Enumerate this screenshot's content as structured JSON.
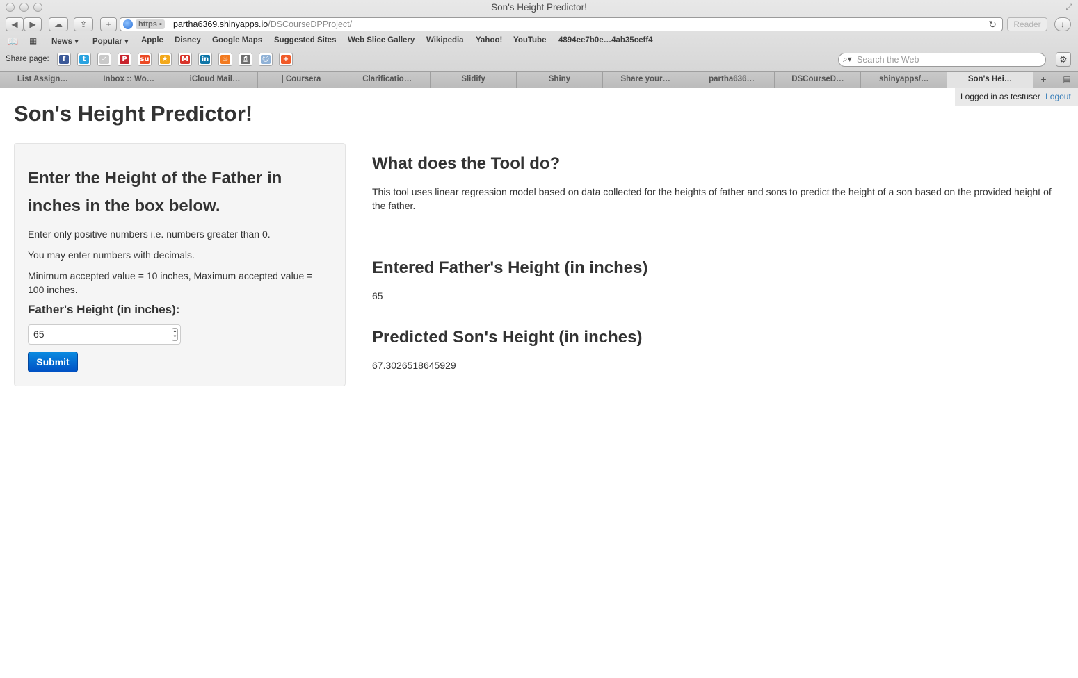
{
  "browser": {
    "window_title": "Son's Height Predictor!",
    "url_scheme": "https",
    "url_host": "partha6369.shinyapps.io",
    "url_path": "/DSCourseDPProject/",
    "reader_label": "Reader",
    "bookmarks": [
      "News ▾",
      "Popular ▾",
      "Apple",
      "Disney",
      "Google Maps",
      "Suggested Sites",
      "Web Slice Gallery",
      "Wikipedia",
      "Yahoo!",
      "YouTube",
      "4894ee7b0e…4ab35ceff4"
    ],
    "share_label": "Share page:",
    "share_icons": [
      {
        "name": "facebook-icon",
        "glyph": "f",
        "color": "#3b5998"
      },
      {
        "name": "twitter-icon",
        "glyph": "t",
        "color": "#2aa3e0"
      },
      {
        "name": "pocket-icon",
        "glyph": "✓",
        "color": "#c9c9c9"
      },
      {
        "name": "pinterest-icon",
        "glyph": "P",
        "color": "#c8232c"
      },
      {
        "name": "stumbleupon-icon",
        "glyph": "su",
        "color": "#eb4924"
      },
      {
        "name": "favorites-icon",
        "glyph": "★",
        "color": "#f3a81b"
      },
      {
        "name": "gmail-icon",
        "glyph": "M",
        "color": "#d8342a"
      },
      {
        "name": "linkedin-icon",
        "glyph": "in",
        "color": "#0e76a8"
      },
      {
        "name": "fire-icon",
        "glyph": "♨",
        "color": "#f27a1f"
      },
      {
        "name": "print-icon",
        "glyph": "⎙",
        "color": "#6d6d6d"
      },
      {
        "name": "reddit-icon",
        "glyph": "☺",
        "color": "#8fb1d6"
      },
      {
        "name": "more-share-icon",
        "glyph": "+",
        "color": "#f05a28"
      }
    ],
    "search_placeholder": "Search the Web",
    "tabs": [
      "List Assign…",
      "Inbox :: Wo…",
      "iCloud Mail…",
      "| Coursera",
      "Clarificatio…",
      "Slidify",
      "Shiny",
      "Share your…",
      "partha636…",
      "DSCourseD…",
      "shinyapps/…",
      "Son's Hei…"
    ],
    "active_tab_index": 11
  },
  "auth": {
    "logged_in_text": "Logged in as testuser",
    "logout_label": "Logout"
  },
  "page": {
    "title": "Son's Height Predictor!"
  },
  "sidebar": {
    "heading": "Enter the Height of the Father in inches in the box below.",
    "note1": "Enter only positive numbers i.e. numbers greater than 0.",
    "note2": "You may enter numbers with decimals.",
    "note3": "Minimum accepted value = 10 inches, Maximum accepted value = 100 inches.",
    "input_label": "Father's Height (in inches):",
    "input_value": "65",
    "submit_label": "Submit"
  },
  "main": {
    "about_heading": "What does the Tool do?",
    "about_text": "This tool uses linear regression model based on data collected for the heights of father and sons to predict the height of a son based on the provided height of the father.",
    "entered_heading": "Entered Father's Height (in inches)",
    "entered_value": "65",
    "predicted_heading": "Predicted Son's Height (in inches)",
    "predicted_value": "67.3026518645929"
  },
  "colors": {
    "button_primary": "#0055c8",
    "link": "#337ab7",
    "well_bg": "#f5f5f5"
  }
}
